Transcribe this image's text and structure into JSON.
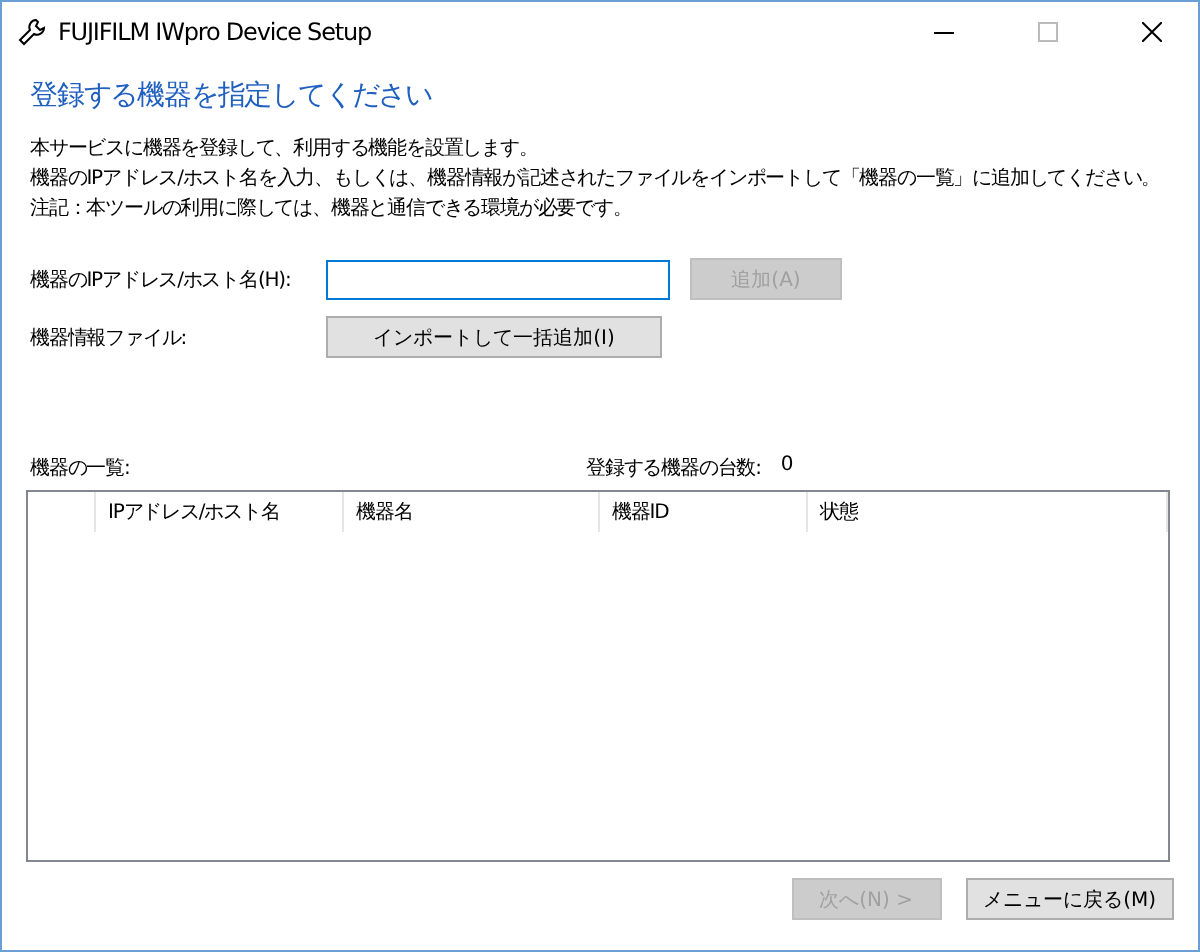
{
  "window": {
    "title": "FUJIFILM IWpro Device Setup"
  },
  "heading": "登録する機器を指定してください",
  "description": [
    "本サービスに機器を登録して、利用する機能を設置します。",
    "機器のIPアドレス/ホスト名を入力、もしくは、機器情報が記述されたファイルをインポートして「機器の一覧」に追加してください。",
    "注記：本ツールの利用に際しては、機器と通信できる環境が必要です。"
  ],
  "address_row": {
    "label": "機器のIPアドレス/ホスト名(H):",
    "add_button": {
      "label": "追加(A)",
      "disabled": true
    }
  },
  "file_row": {
    "label": "機器情報ファイル:",
    "button": {
      "label": "インポートして一括追加(I)",
      "disabled": false
    }
  },
  "list": {
    "label": "機器の一覧:",
    "count_label": "登録する機器の台数:",
    "count": "0",
    "columns": [
      "IPアドレス/ホスト名",
      "機器名",
      "機器ID",
      "状態"
    ]
  },
  "footer": [
    {
      "label": "次へ(N) >",
      "disabled": true
    },
    {
      "label": "メニューに戻る(M)",
      "disabled": false
    }
  ]
}
